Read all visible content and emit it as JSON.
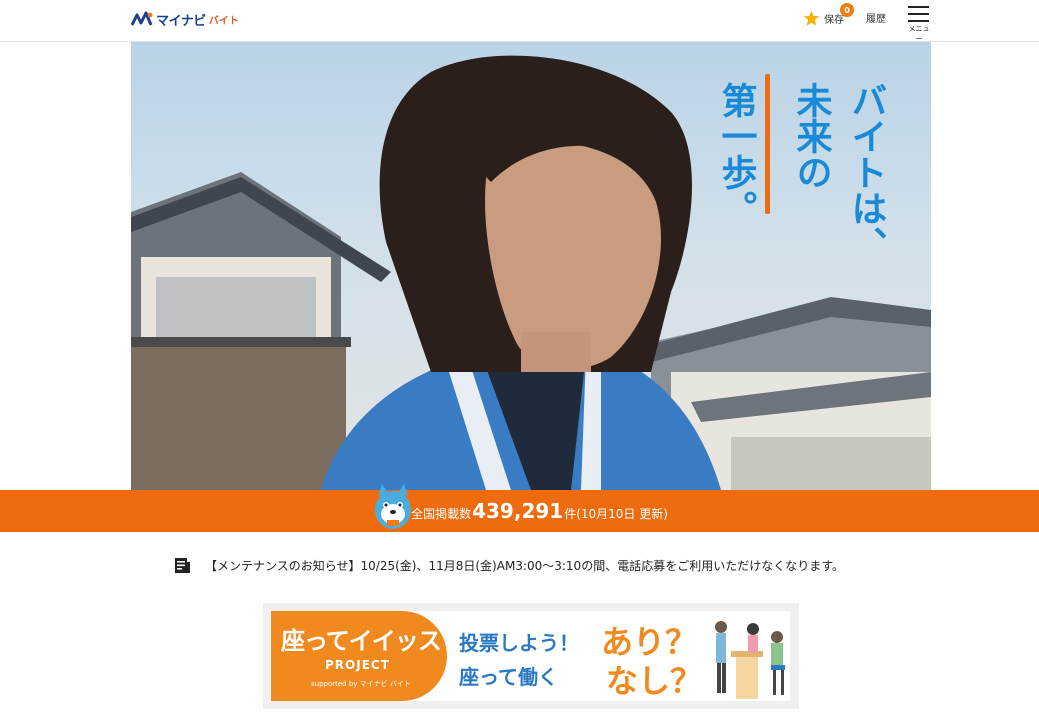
{
  "header": {
    "logo_name": "マイナビ",
    "logo_sub": "バイト",
    "save_label": "保存",
    "save_count": "0",
    "history_label": "履歴",
    "menu_label": "メニュー"
  },
  "hero": {
    "copy_line1": "バイトは、",
    "copy_line2": "未来の",
    "copy_line3": "第一歩。"
  },
  "count_bar": {
    "label": "全国掲載数",
    "number": "439,291",
    "unit": "件",
    "updated": "(10月10日 更新)"
  },
  "notice": {
    "text": "【メンテナンスのお知らせ】10/25(金)、11月8日(金)AM3:00～3:10の間、電話応募をご利用いただけなくなります。"
  },
  "banner": {
    "title": "座ってイイッス",
    "project": "PROJECT",
    "supported": "supported by マイナビ バイト",
    "vote": "投票しよう！",
    "sit_work": "座って働く",
    "ari": "あり？",
    "nashi": "なし？"
  },
  "colors": {
    "accent": "#ee6b0f",
    "brand_blue": "#1d3f8f",
    "copy_blue": "#1a8ad8"
  }
}
